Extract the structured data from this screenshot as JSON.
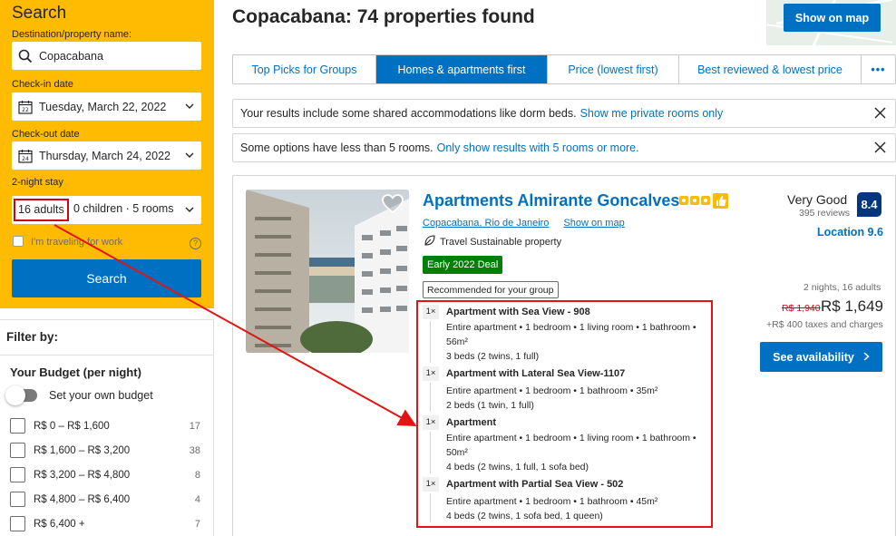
{
  "colors": {
    "brand_yellow": "#febb02",
    "primary_blue": "#0071c2",
    "dark_blue": "#003580",
    "deal_green": "#008009",
    "annotation_red": "#e21414"
  },
  "search": {
    "title": "Search",
    "destination_label": "Destination/property name:",
    "destination_value": "Copacabana",
    "checkin_label": "Check-in date",
    "checkin_value": "Tuesday, March 22, 2022",
    "checkin_day": "22",
    "checkout_label": "Check-out date",
    "checkout_value": "Thursday, March 24, 2022",
    "checkout_day": "24",
    "stay_length": "2-night stay",
    "adults": "16 adults",
    "children_rooms": "0 children · 5 rooms",
    "work_travel": "I'm traveling for work",
    "help": "?",
    "button": "Search"
  },
  "filters": {
    "title": "Filter by:",
    "budget_title": "Your Budget (per night)",
    "own_budget": "Set your own budget",
    "budget_ranges": [
      {
        "label": "R$ 0 – R$ 1,600",
        "count": "17"
      },
      {
        "label": "R$ 1,600 – R$ 3,200",
        "count": "38"
      },
      {
        "label": "R$ 3,200 – R$ 4,800",
        "count": "8"
      },
      {
        "label": "R$ 4,800 – R$ 6,400",
        "count": "4"
      },
      {
        "label": "R$ 6,400 +",
        "count": "7"
      }
    ]
  },
  "header": {
    "title": "Copacabana: 74 properties found",
    "map_button": "Show on map"
  },
  "tabs": [
    {
      "label": "Top Picks for Groups"
    },
    {
      "label": "Homes & apartments first"
    },
    {
      "label": "Price (lowest first)"
    },
    {
      "label": "Best reviewed & lowest price"
    },
    {
      "label": "•••"
    }
  ],
  "notices": [
    {
      "text": "Your results include some shared accommodations like dorm beds.",
      "link": "Show me private rooms only"
    },
    {
      "text": "Some options have less than 5 rooms.",
      "link": "Only show results with 5 rooms or more."
    }
  ],
  "property": {
    "name": "Apartments Almirante Goncalves",
    "location": "Copacabana, Rio de Janeiro",
    "map_link": "Show on map",
    "sustainable": "Travel Sustainable property",
    "deal": "Early 2022 Deal",
    "recommended": "Recommended for your group",
    "rating_word": "Very Good",
    "reviews": "395 reviews",
    "score": "8.4",
    "location_score": "Location 9.6",
    "stay_info": "2 nights, 16 adults",
    "old_price": "R$ 1,940",
    "price": "R$ 1,649",
    "taxes": "+R$ 400 taxes and charges",
    "availability_button": "See availability",
    "units": [
      {
        "qty": "1×",
        "name": "Apartment with Sea View - 908",
        "details": "Entire apartment • 1 bedroom • 1 living room • 1 bathroom • 56m²",
        "beds": "3 beds (2 twins, 1 full)"
      },
      {
        "qty": "1×",
        "name": "Apartment with Lateral Sea View-1107",
        "details": "Entire apartment • 1 bedroom • 1 bathroom • 35m²",
        "beds": "2 beds (1 twin, 1 full)"
      },
      {
        "qty": "1×",
        "name": "Apartment",
        "details": "Entire apartment • 1 bedroom • 1 living room • 1 bathroom • 50m²",
        "beds": "4 beds (2 twins, 1 full, 1 sofa bed)"
      },
      {
        "qty": "1×",
        "name": "Apartment with Partial Sea View - 502",
        "details": "Entire apartment • 1 bedroom • 1 bathroom • 45m²",
        "beds": "4 beds (2 twins, 1 sofa bed, 1 queen)"
      }
    ]
  }
}
